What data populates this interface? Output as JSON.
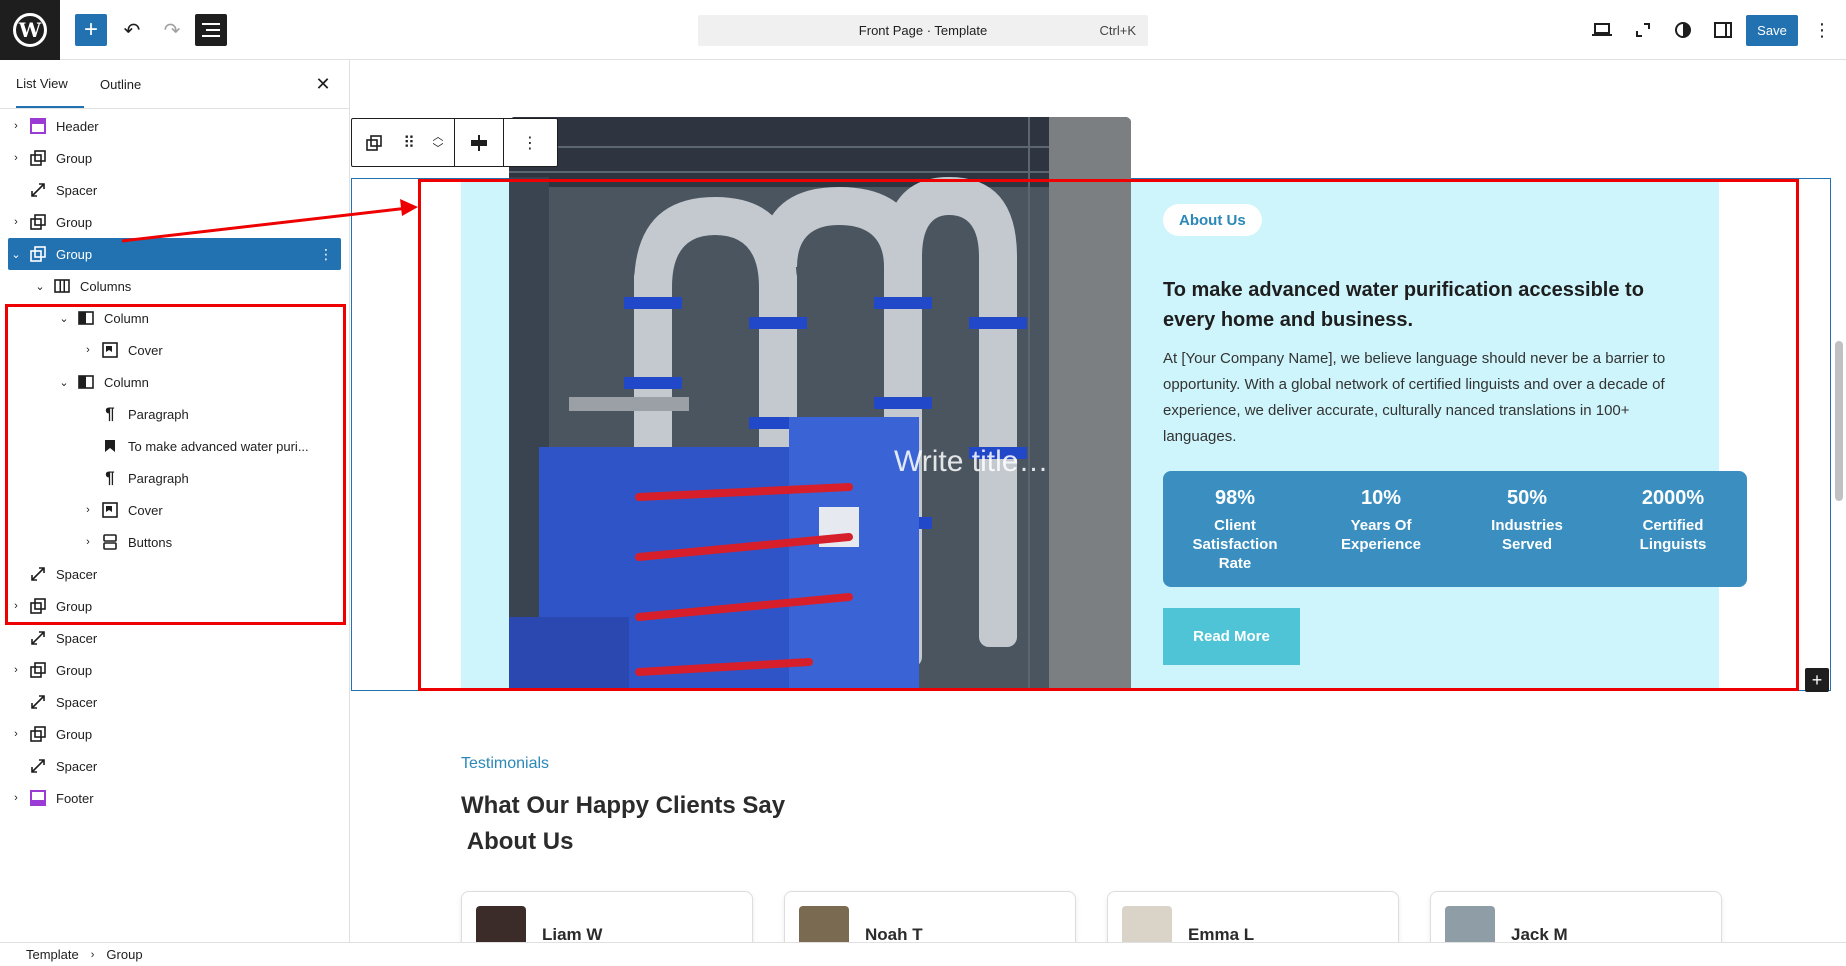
{
  "topbar": {
    "title": "Front Page · Template",
    "shortcut": "Ctrl+K",
    "save_label": "Save",
    "accent": "#2271b1"
  },
  "sidebar": {
    "tab_list": "List View",
    "tab_outline": "Outline",
    "items": [
      {
        "label": "Header"
      },
      {
        "label": "Group"
      },
      {
        "label": "Spacer"
      },
      {
        "label": "Group"
      },
      {
        "label": "Group"
      },
      {
        "label": "Columns"
      },
      {
        "label": "Column"
      },
      {
        "label": "Cover"
      },
      {
        "label": "Column"
      },
      {
        "label": "Paragraph"
      },
      {
        "label": "To make advanced water puri..."
      },
      {
        "label": "Paragraph"
      },
      {
        "label": "Cover"
      },
      {
        "label": "Buttons"
      },
      {
        "label": "Spacer"
      },
      {
        "label": "Group"
      },
      {
        "label": "Spacer"
      },
      {
        "label": "Group"
      },
      {
        "label": "Spacer"
      },
      {
        "label": "Group"
      },
      {
        "label": "Spacer"
      },
      {
        "label": "Footer"
      }
    ]
  },
  "breadcrumb": {
    "root": "Template",
    "current": "Group"
  },
  "canvas": {
    "cover_title_placeholder": "Write title…",
    "about_pill": "About Us",
    "about_heading": "To make advanced water purification accessible to every home and business.",
    "about_para": "At [Your Company Name], we believe language should never be a barrier to opportunity. With a global network of certified linguists and over a decade of experience, we deliver accurate, culturally nanced translations in 100+ languages.",
    "stats": [
      {
        "num": "98%",
        "label": "Client Satisfaction Rate"
      },
      {
        "num": "10%",
        "label": "Years Of Experience"
      },
      {
        "num": "50%",
        "label": "Industries Served"
      },
      {
        "num": "2000%",
        "label": "Certified Linguists"
      }
    ],
    "read_more": "Read More",
    "testimonials_kicker": "Testimonials",
    "testimonials_heading": "What Our Happy Clients Say\n About Us",
    "cards": [
      {
        "name": "Liam W"
      },
      {
        "name": "Noah T"
      },
      {
        "name": "Emma L"
      },
      {
        "name": "Jack M"
      }
    ]
  }
}
